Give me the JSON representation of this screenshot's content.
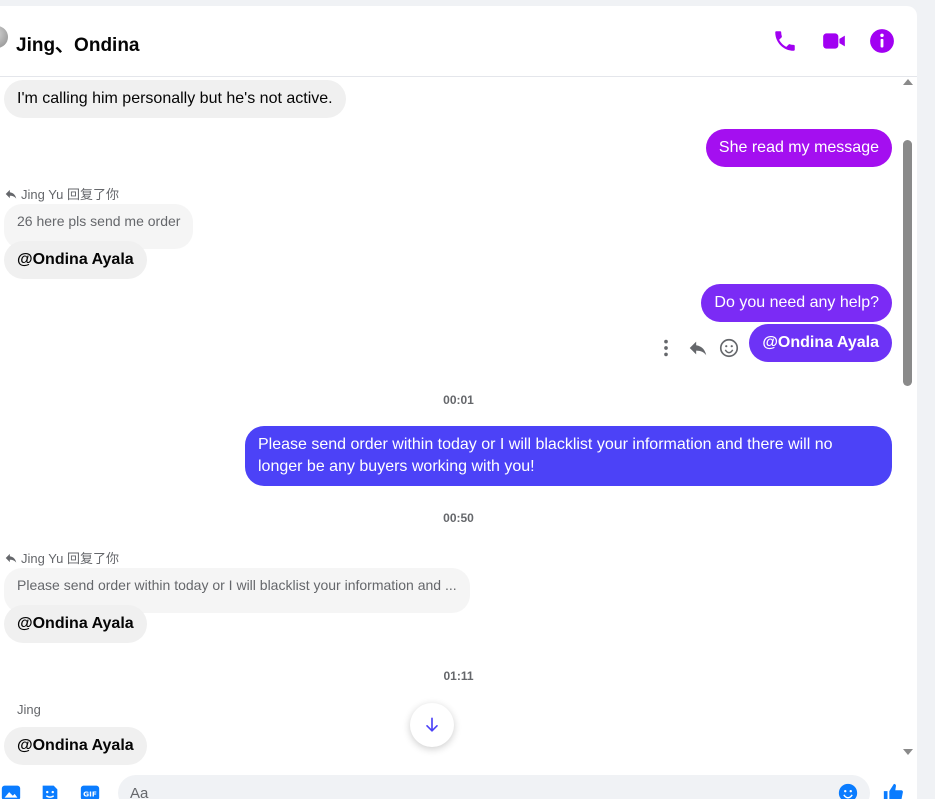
{
  "header": {
    "title": "Jing、Ondina",
    "accent_color": "#a100f2",
    "icons": [
      "phone-icon",
      "video-camera-icon",
      "info-icon"
    ]
  },
  "messages": {
    "m1_text": "I'm calling him personally but he's not active.",
    "m2_text": "She read my message",
    "m3_reply_label": "Jing Yu 回复了你",
    "m3_quoted": "26 here pls send me order",
    "m3_text": "@Ondina Ayala",
    "m4_text": "Do you need any help?",
    "m5_text": "@Ondina Ayala",
    "time1": "00:01",
    "m6_text": "Please send order within today or I will blacklist your information and there will no longer be any buyers working with you!",
    "time2": "00:50",
    "m7_reply_label": "Jing Yu 回复了你",
    "m7_quoted": "Please send order within today or I will blacklist your information and ...",
    "m7_text": "@Ondina Ayala",
    "time3": "01:11",
    "m8_sender": "Jing",
    "m8_text": "@Ondina Ayala"
  },
  "bubble_colors": {
    "m2": "#a40ff0",
    "m4": "#7b2bf5",
    "m5": "#6d33f6",
    "m6": "#4c42f7"
  },
  "composer": {
    "placeholder": "Aa"
  }
}
